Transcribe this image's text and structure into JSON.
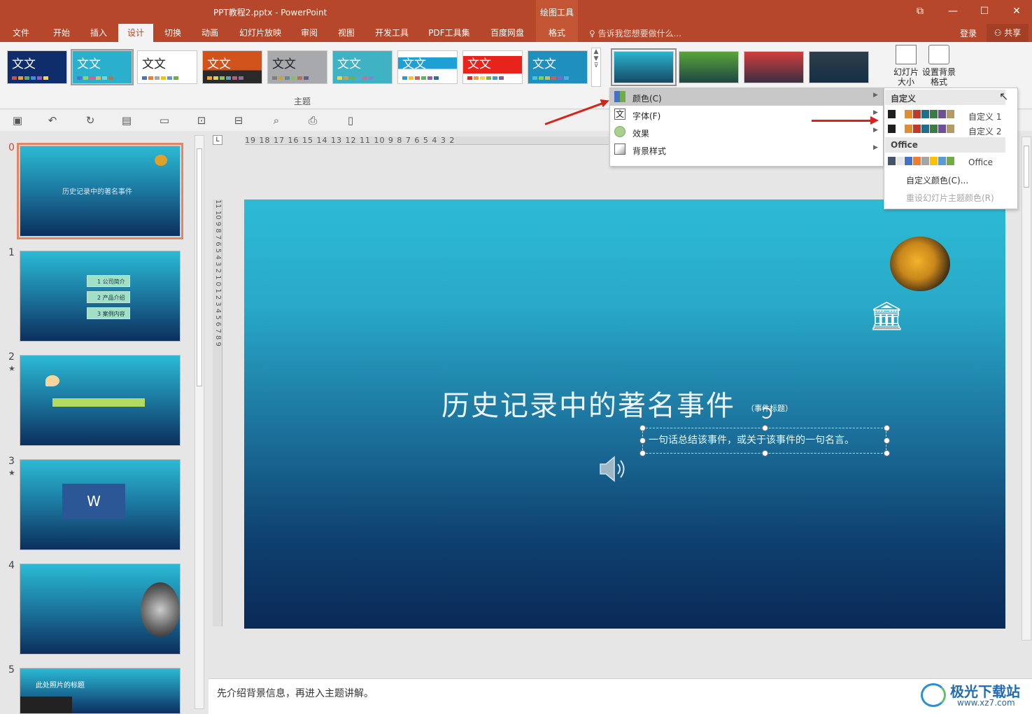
{
  "window": {
    "title": "PPT教程2.pptx - PowerPoint",
    "context_group": "绘图工具",
    "restore_icon": "⧉",
    "minimize_icon": "—",
    "maximize_icon": "☐",
    "close_icon": "✕"
  },
  "tabs": [
    "文件",
    "开始",
    "插入",
    "设计",
    "切换",
    "动画",
    "幻灯片放映",
    "审阅",
    "视图",
    "开发工具",
    "PDF工具集",
    "百度网盘",
    "格式"
  ],
  "tell_me": "告诉我您想要做什么...",
  "login": "登录",
  "share": "共享",
  "ribbon": {
    "theme_sample": "文文",
    "themes_group_label": "主题",
    "slide_size_label": "幻灯片大小",
    "format_bg_label": "设置背景格式"
  },
  "themes": [
    {
      "bg": "#0f2d6b",
      "fg": "#ffffff",
      "dots": [
        "#e04a2b",
        "#f0a020",
        "#5fb04a",
        "#3c8fd8",
        "#a64fd1",
        "#ffd34d"
      ]
    },
    {
      "bg": "#2ab0cc",
      "fg": "#ffffff",
      "dots": [
        "#5b6cd6",
        "#9ed63f",
        "#e35b8e",
        "#f2b53b",
        "#7ad3d3",
        "#d36b2d"
      ]
    },
    {
      "bg": "#ffffff",
      "fg": "#222222",
      "dots": [
        "#4472c4",
        "#ed7d31",
        "#a5a5a5",
        "#ffc000",
        "#5b9bd5",
        "#70ad47"
      ]
    },
    {
      "bg": "#d2521c",
      "fg": "#ffffff",
      "dots": [
        "#f7a42b",
        "#e6d14a",
        "#92c160",
        "#4ba8c7",
        "#bd5b7f",
        "#8b6aa8"
      ]
    },
    {
      "bg": "#a7a9ac",
      "fg": "#222222",
      "dots": [
        "#7f7f7f",
        "#c9a23f",
        "#5e8a9a",
        "#8bbf5d",
        "#c26b4f",
        "#6a5a8b"
      ]
    },
    {
      "bg": "#3fb3c4",
      "fg": "#ffffff",
      "dots": [
        "#f6d14a",
        "#f0913a",
        "#6fb24b",
        "#5aa6d2",
        "#c66e9d",
        "#8d7fd3"
      ]
    },
    {
      "bg": "#ffffff",
      "fg": "#ffffff",
      "dots": [
        "#1ea0d5",
        "#f6c02f",
        "#e9574c",
        "#5fb55b",
        "#965bb5",
        "#2b6f9a"
      ]
    },
    {
      "bg": "#ffffff",
      "fg": "#ffffff",
      "dots": [
        "#e8231c",
        "#f59b26",
        "#f6d44f",
        "#7cb441",
        "#3f9bd2",
        "#9256a0"
      ]
    },
    {
      "bg": "#1f8fbd",
      "fg": "#ffffff",
      "dots": [
        "#48c3d6",
        "#86d04c",
        "#e4b73b",
        "#e0584e",
        "#8b62c9",
        "#52a9e6"
      ]
    }
  ],
  "variants": [
    {
      "bg": "#2bb4cf"
    },
    {
      "bg": "#5aa43a"
    },
    {
      "bg": "#d33d3b"
    },
    {
      "bg": "#2f3e4a"
    }
  ],
  "menu": {
    "items": [
      {
        "label": "颜色(C)",
        "icon": "color-palette-icon"
      },
      {
        "label": "字体(F)",
        "icon": "font-icon"
      },
      {
        "label": "效果",
        "icon": "effects-icon"
      },
      {
        "label": "背景样式",
        "icon": "background-style-icon"
      }
    ]
  },
  "colors_menu": {
    "custom_header": "自定义",
    "custom": [
      {
        "label": "自定义 1",
        "swatches": [
          "#1f1f1f",
          "#ffffff",
          "#e48c2b",
          "#c0392b",
          "#1f6f8b",
          "#3a7d44",
          "#6c4f96",
          "#b59a66"
        ]
      },
      {
        "label": "自定义 2",
        "swatches": [
          "#1f1f1f",
          "#ffffff",
          "#e48c2b",
          "#c0392b",
          "#1f6f8b",
          "#3a7d44",
          "#6c4f96",
          "#b59a66"
        ]
      }
    ],
    "office_header": "Office",
    "office": [
      {
        "label": "Office",
        "swatches": [
          "#44546a",
          "#e7e6e6",
          "#4472c4",
          "#ed7d31",
          "#a5a5a5",
          "#ffc000",
          "#5b9bd5",
          "#70ad47"
        ]
      }
    ],
    "custom_colors_link": "自定义颜色(C)...",
    "reset_link": "重设幻灯片主题颜色(R)"
  },
  "thumbnails": [
    {
      "num": "0",
      "star": false,
      "text": "历史记录中的著名事件"
    },
    {
      "num": "1",
      "star": false,
      "items": [
        "1 公司简介",
        "2 产品介绍",
        "3 案例内容"
      ]
    },
    {
      "num": "2",
      "star": true
    },
    {
      "num": "3",
      "star": true
    },
    {
      "num": "4",
      "star": false
    },
    {
      "num": "5",
      "star": false,
      "text": "此处照片的标题"
    }
  ],
  "ruler": {
    "h": "19 18 17 16 15 14 13 12 11 10 9 8 7 6 5 4 3 2",
    "v": "11 10 9 8 7 6 5 4 3 2 1 0 1 2 3 4 5 6 7 8 9"
  },
  "slide": {
    "title": "历史记录中的著名事件",
    "tag": "（事件标题）",
    "subtitle": "一句话总结该事件，或关于该事件的一句名言。"
  },
  "notes": "先介绍背景信息，再进入主题讲解。",
  "watermark": {
    "title": "极光下载站",
    "url": "www.xz7.com"
  }
}
